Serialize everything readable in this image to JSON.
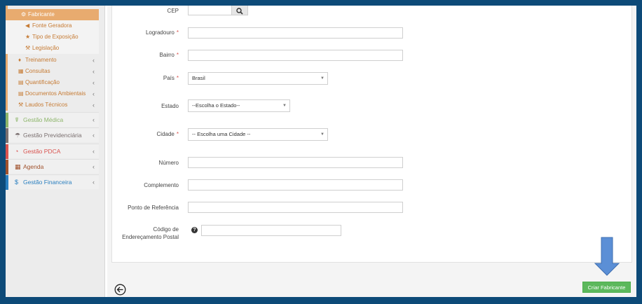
{
  "sidebar": {
    "active_sub": {
      "label": "Fabricante",
      "icon": "cogs-icon"
    },
    "sub_items": [
      {
        "label": "Fonte Geradora",
        "icon": "bullhorn-icon"
      },
      {
        "label": "Tipo de Exposição",
        "icon": "star-icon"
      },
      {
        "label": "Legislação",
        "icon": "gavel-icon"
      }
    ],
    "module_items": [
      {
        "label": "Treinamento",
        "icon": "lightbulb-icon"
      },
      {
        "label": "Consultas",
        "icon": "table-icon"
      },
      {
        "label": "Quantificação",
        "icon": "book-icon"
      },
      {
        "label": "Documentos Ambientais",
        "icon": "book-icon"
      },
      {
        "label": "Laudos Técnicos",
        "icon": "gavel-icon"
      }
    ],
    "sections": [
      {
        "label": "Gestão Médica",
        "color": "#8db56a",
        "icon": "stethoscope-icon"
      },
      {
        "label": "Gestão Previdenciária",
        "color": "#7a6f6f",
        "icon": "umbrella-icon"
      },
      {
        "label": "Gestão PDCA",
        "color": "#d9534f",
        "icon": "pie-chart-icon"
      },
      {
        "label": "Agenda",
        "color": "#a0522d",
        "icon": "calendar-icon"
      },
      {
        "label": "Gestão Financeira",
        "color": "#2a7fbf",
        "icon": "dollar-icon"
      }
    ]
  },
  "form": {
    "cep_label": "CEP",
    "logradouro_label": "Logradouro",
    "bairro_label": "Bairro",
    "pais_label": "País",
    "pais_value": "Brasil",
    "estado_label": "Estado",
    "estado_value": "--Escolha o Estado--",
    "cidade_label": "Cidade",
    "cidade_value": "-- Escolha uma Cidade --",
    "numero_label": "Número",
    "complemento_label": "Complemento",
    "referencia_label": "Ponto de Referência",
    "cep_postal_label_1": "Código de",
    "cep_postal_label_2": "Endereçamento Postal",
    "required_mark": "*"
  },
  "actions": {
    "create_label": "Criar Fabricante"
  }
}
